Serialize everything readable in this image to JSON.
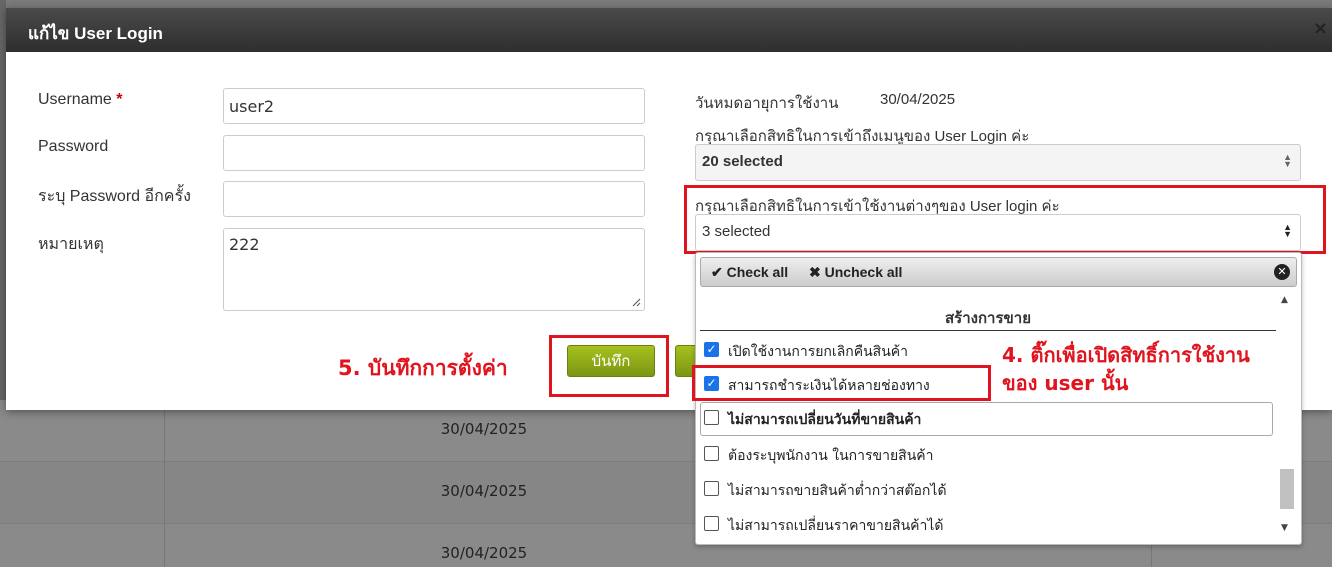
{
  "modal": {
    "title": "แก้ไข User Login",
    "close_glyph": "×"
  },
  "form": {
    "username_label": "Username",
    "required_mark": "*",
    "username_value": "user2",
    "password_label": "Password",
    "password_value": "",
    "confirm_label": "ระบุ Password อีกครั้ง",
    "confirm_value": "",
    "note_label": "หมายเหตุ",
    "note_value": "222"
  },
  "right": {
    "expiry_label": "วันหมดอายุการใช้งาน",
    "expiry_value": "30/04/2025",
    "menu_perm_label": "กรุณาเลือกสิทธิในการเข้าถึงเมนูของ User Login ค่ะ",
    "menu_perm_value": "20 selected",
    "usage_perm_label": "กรุณาเลือกสิทธิในการเข้าใช้งานต่างๆของ User login ค่ะ",
    "usage_perm_value": "3 selected"
  },
  "dropdown": {
    "check_all": "Check all",
    "uncheck_all": "Uncheck all",
    "group_title": "สร้างการขาย",
    "items": [
      {
        "label": "เปิดใช้งานการยกเลิกคืนสินค้า",
        "checked": true
      },
      {
        "label": "สามารถชำระเงินได้หลายช่องทาง",
        "checked": true
      },
      {
        "label": "ไม่สามารถเปลี่ยนวันที่ขายสินค้า",
        "checked": false
      },
      {
        "label": "ต้องระบุพนักงาน ในการขายสินค้า",
        "checked": false
      },
      {
        "label": "ไม่สามารถขายสินค้าต่ำกว่าสต๊อกได้",
        "checked": false
      },
      {
        "label": "ไม่สามารถเปลี่ยนราคาขายสินค้าได้",
        "checked": false
      }
    ]
  },
  "buttons": {
    "save_label": "บันทึก"
  },
  "annotations": {
    "step5": "5. บันทึกการตั้งค่า",
    "step4_line1": "4. ติ๊กเพื่อเปิดสิทธิ์การใช้งาน",
    "step4_line2": "ของ user นั้น"
  },
  "background": {
    "dates": [
      "30/04/2025",
      "30/04/2025",
      "30/04/2025"
    ]
  },
  "colors": {
    "annotation_red": "#e0141e",
    "save_green": "#8fae18",
    "header_dark": "#3a3a3a",
    "checkbox_blue": "#1a73e8"
  }
}
